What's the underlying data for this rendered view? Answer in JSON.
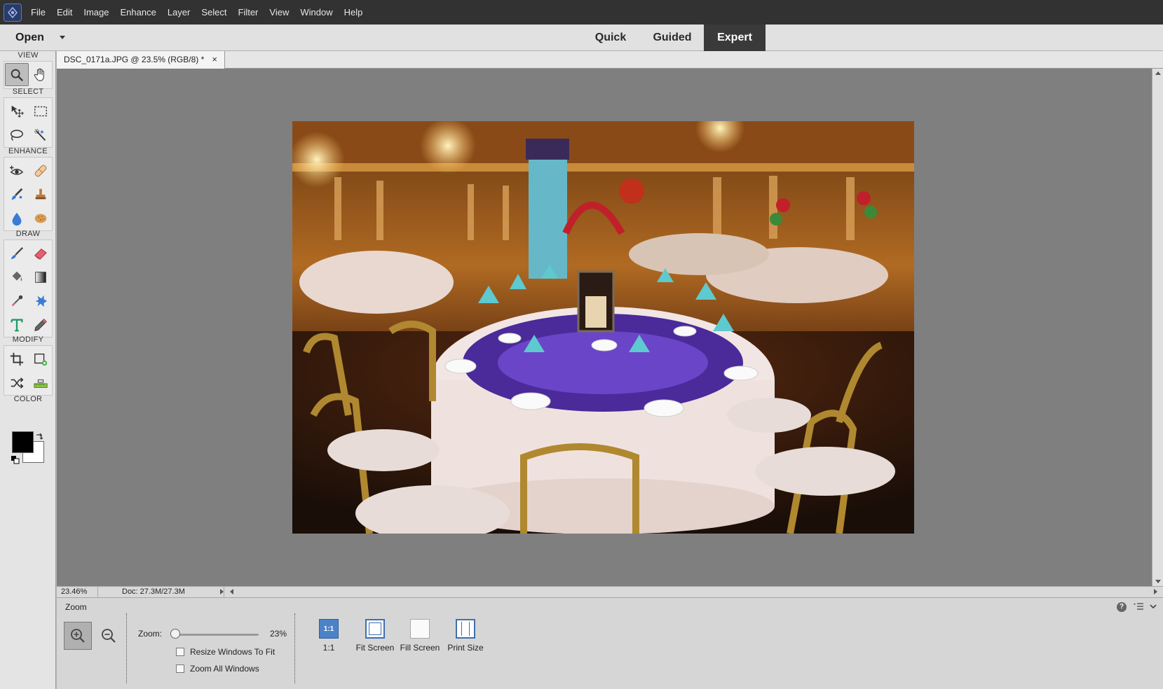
{
  "menu": {
    "items": [
      "File",
      "Edit",
      "Image",
      "Enhance",
      "Layer",
      "Select",
      "Filter",
      "View",
      "Window",
      "Help"
    ]
  },
  "modebar": {
    "open_label": "Open",
    "tabs": [
      "Quick",
      "Guided",
      "Expert"
    ],
    "active_tab": "Expert"
  },
  "toolbox": {
    "sections": [
      "VIEW",
      "SELECT",
      "ENHANCE",
      "DRAW",
      "MODIFY",
      "COLOR"
    ],
    "tools": {
      "view": [
        "zoom-icon",
        "hand-icon"
      ],
      "select": [
        "move-icon",
        "marquee-icon",
        "lasso-icon",
        "quick-selection-icon"
      ],
      "enhance": [
        "red-eye-icon",
        "spot-healing-icon",
        "smart-brush-icon",
        "clone-stamp-icon",
        "blur-icon",
        "sponge-icon"
      ],
      "draw": [
        "brush-icon",
        "eraser-icon",
        "paint-bucket-icon",
        "gradient-icon",
        "eyedropper-icon",
        "custom-shape-icon",
        "type-icon",
        "pencil-icon"
      ],
      "modify": [
        "crop-icon",
        "recompose-icon",
        "content-aware-move-icon",
        "straighten-icon"
      ]
    },
    "colors": {
      "foreground": "#000000",
      "background": "#ffffff"
    }
  },
  "document": {
    "tab_title": "DSC_0171a.JPG @ 23.5% (RGB/8) *",
    "close_glyph": "×"
  },
  "status": {
    "zoom": "23.46%",
    "doc_size": "Doc: 27.3M/27.3M"
  },
  "options": {
    "title": "Zoom",
    "zoom_label": "Zoom:",
    "zoom_value": "23%",
    "zoom_slider_fraction": 0.02,
    "resize_windows_label": "Resize Windows To Fit",
    "zoom_all_label": "Zoom All Windows",
    "view_buttons": [
      {
        "label": "1:1",
        "icon_text": "1:1"
      },
      {
        "label": "Fit Screen"
      },
      {
        "label": "Fill Screen"
      },
      {
        "label": "Print Size"
      }
    ],
    "help_glyph": "?"
  },
  "colors": {
    "menubar": "#323232",
    "expert_tab_bg": "#3a3a3a",
    "canvas_bg": "#7f7f7f",
    "accent_blue": "#4c82c8"
  }
}
